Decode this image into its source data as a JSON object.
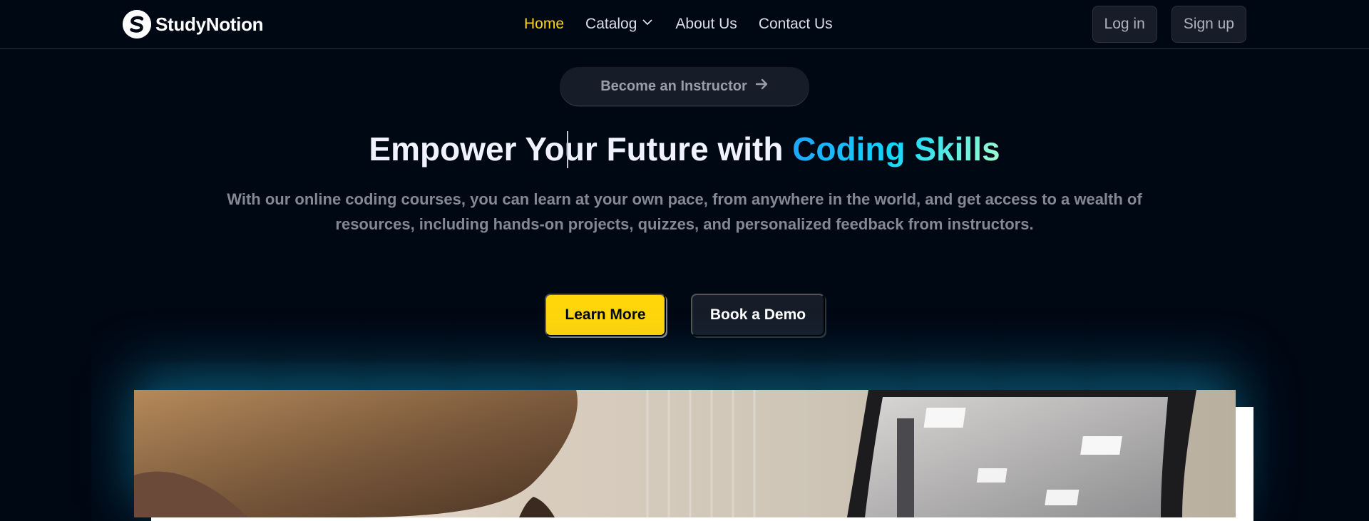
{
  "navbar": {
    "brand": "StudyNotion",
    "links": [
      {
        "label": "Home",
        "active": true
      },
      {
        "label": "Catalog",
        "has_dropdown": true
      },
      {
        "label": "About Us"
      },
      {
        "label": "Contact Us"
      }
    ],
    "login_label": "Log in",
    "signup_label": "Sign up"
  },
  "hero": {
    "instructor_button": "Become an Instructor",
    "title_part1": "Empower Your Future with ",
    "title_highlight": "Coding Skills",
    "subtitle": "With our online coding courses, you can learn at your own pace, from anywhere in the world, and get access to a wealth of resources, including hands-on projects, quizzes, and personalized feedback from instructors.",
    "learn_more": "Learn More",
    "book_demo": "Book a Demo"
  },
  "colors": {
    "background": "#000814",
    "accent_yellow": "#FFD60A",
    "active_link": "#FFD60A",
    "surface": "#161D29",
    "gradient_start": "#1FA2FF",
    "gradient_end": "#A6FFCB"
  },
  "icons": [
    "logo-s-icon",
    "chevron-down-icon",
    "arrow-right-icon"
  ]
}
